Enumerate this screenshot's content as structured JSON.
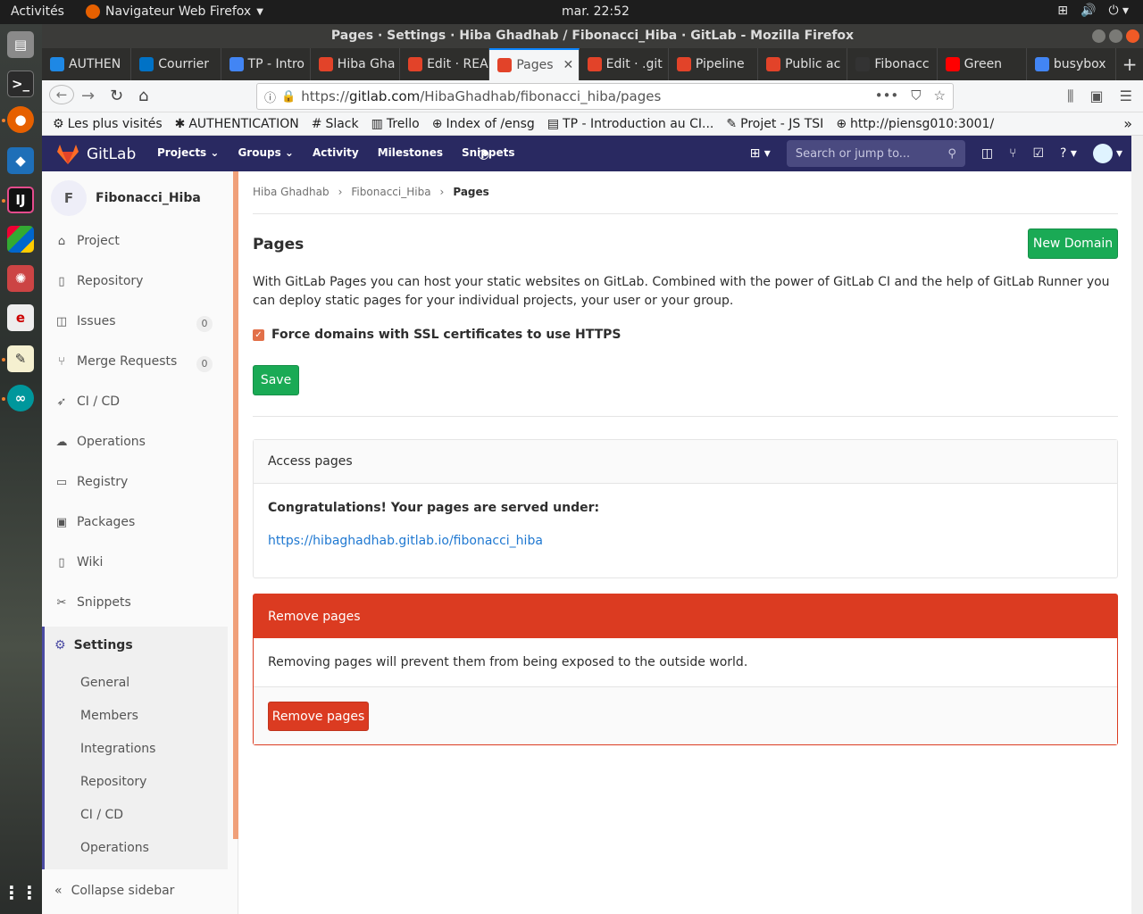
{
  "os": {
    "activities": "Activités",
    "app_name": "Navigateur Web Firefox",
    "clock": "mar. 22:52"
  },
  "window": {
    "title": "Pages · Settings · Hiba Ghadhab / Fibonacci_Hiba · GitLab - Mozilla Firefox"
  },
  "tabs": [
    {
      "label": "AUTHEN",
      "color": "#1e88e5"
    },
    {
      "label": "Courrier",
      "color": "#0072c6"
    },
    {
      "label": "TP - Intro",
      "color": "#4285f4"
    },
    {
      "label": "Hiba Gha",
      "color": "#e24329"
    },
    {
      "label": "Edit · REA",
      "color": "#e24329"
    },
    {
      "label": "Pages",
      "color": "#e24329"
    },
    {
      "label": "Edit · .git",
      "color": "#e24329"
    },
    {
      "label": "Pipeline",
      "color": "#e24329"
    },
    {
      "label": "Public ac",
      "color": "#e24329"
    },
    {
      "label": "Fibonacc",
      "color": "#333333"
    },
    {
      "label": "Green",
      "color": "#ff0000"
    },
    {
      "label": "busybox",
      "color": "#4285f4"
    }
  ],
  "urlbar": {
    "prefix": "https://",
    "host": "gitlab.com",
    "path": "/HibaGhadhab/fibonacci_hiba/pages"
  },
  "bookmarks": [
    "Les plus visités",
    "AUTHENTICATION",
    "Slack",
    "Trello",
    "Index of /ensg",
    "TP - Introduction au CI...",
    "Projet - JS TSI",
    "http://piensg010:3001/"
  ],
  "gitlab": {
    "brand": "GitLab",
    "nav": [
      "Projects",
      "Groups",
      "Activity",
      "Milestones",
      "Snippets"
    ],
    "search_placeholder": "Search or jump to..."
  },
  "sidebar": {
    "avatar_letter": "F",
    "project_name": "Fibonacci_Hiba",
    "items": [
      {
        "label": "Project",
        "icon": "home-icon"
      },
      {
        "label": "Repository",
        "icon": "repo-icon"
      },
      {
        "label": "Issues",
        "icon": "issues-icon",
        "count": "0"
      },
      {
        "label": "Merge Requests",
        "icon": "merge-icon",
        "count": "0"
      },
      {
        "label": "CI / CD",
        "icon": "rocket-icon"
      },
      {
        "label": "Operations",
        "icon": "cloud-icon"
      },
      {
        "label": "Registry",
        "icon": "registry-icon"
      },
      {
        "label": "Packages",
        "icon": "package-icon"
      },
      {
        "label": "Wiki",
        "icon": "book-icon"
      },
      {
        "label": "Snippets",
        "icon": "scissors-icon"
      }
    ],
    "settings_label": "Settings",
    "settings_sub": [
      "General",
      "Members",
      "Integrations",
      "Repository",
      "CI / CD",
      "Operations"
    ],
    "collapse_label": "Collapse sidebar"
  },
  "main": {
    "breadcrumb": [
      "Hiba Ghadhab",
      "Fibonacci_Hiba",
      "Pages"
    ],
    "title": "Pages",
    "new_domain": "New Domain",
    "description": "With GitLab Pages you can host your static websites on GitLab. Combined with the power of GitLab CI and the help of GitLab Runner you can deploy static pages for your individual projects, your user or your group.",
    "checkbox_label": "Force domains with SSL certificates to use HTTPS",
    "checkbox_checked": true,
    "save": "Save",
    "access": {
      "header": "Access pages",
      "congrats": "Congratulations! Your pages are served under:",
      "link": "https://hibaghadhab.gitlab.io/fibonacci_hiba"
    },
    "remove": {
      "header": "Remove pages",
      "text": "Removing pages will prevent them from being exposed to the outside world.",
      "button": "Remove pages"
    }
  }
}
